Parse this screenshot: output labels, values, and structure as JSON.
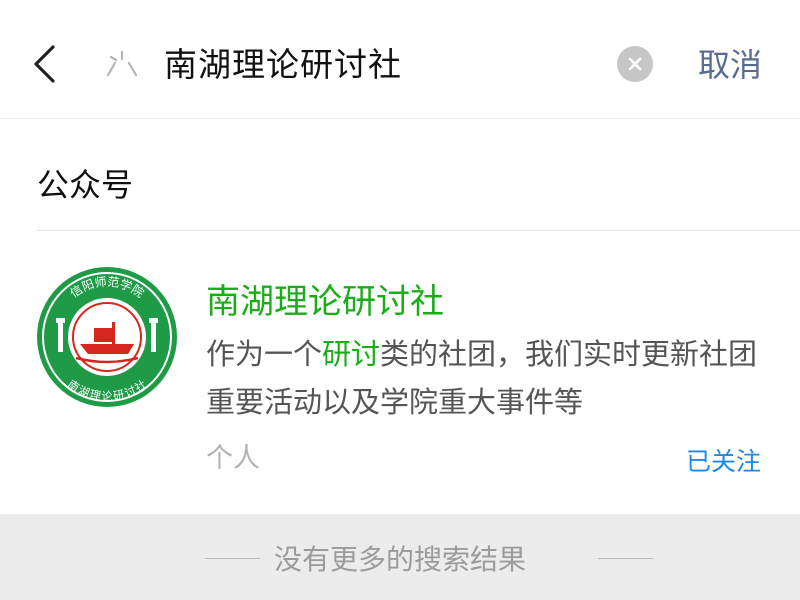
{
  "header": {
    "search_query": "南湖理论研讨社",
    "cancel_label": "取消"
  },
  "section": {
    "title": "公众号"
  },
  "result": {
    "name": "南湖理论研讨社",
    "description_before": "作为一个",
    "description_highlight": "研讨",
    "description_after": "类的社团，我们实时更新社团重要活动以及学院重大事件等",
    "type": "个人",
    "follow_status": "已关注",
    "logo": {
      "top_text": "信阳师范学院",
      "bottom_text": "南湖理论研讨社"
    }
  },
  "footer": {
    "text": "没有更多的搜索结果"
  },
  "colors": {
    "accent_green": "#1aad19",
    "link_blue": "#1e88e5",
    "cancel_blue": "#5a6b8f"
  },
  "icons": [
    "back-arrow-icon",
    "search-icon",
    "clear-icon"
  ]
}
